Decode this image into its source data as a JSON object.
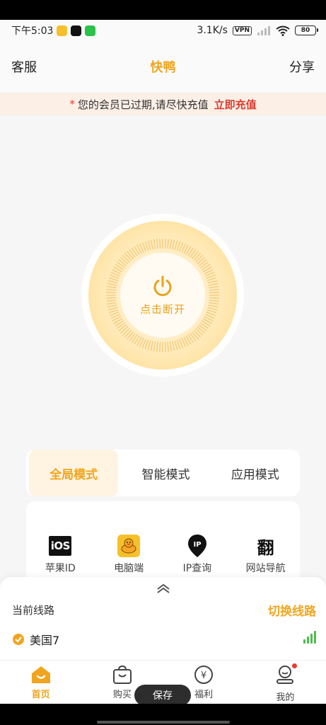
{
  "status_bar": {
    "time": "下午5:03",
    "network_speed": "3.1K/s",
    "vpn": "VPN",
    "battery": "80"
  },
  "nav": {
    "left": "客服",
    "title": "快鸭",
    "right": "分享"
  },
  "banner": {
    "star": "*",
    "message": "您的会员已过期,请尽快充值",
    "action": "立即充值"
  },
  "power": {
    "label": "点击断开"
  },
  "modes": [
    {
      "label": "全局模式",
      "active": true
    },
    {
      "label": "智能模式",
      "active": false
    },
    {
      "label": "应用模式",
      "active": false
    }
  ],
  "tools": [
    {
      "label": "苹果ID",
      "icon": "ios-icon",
      "icon_text": "iOS"
    },
    {
      "label": "电脑端",
      "icon": "duck-icon"
    },
    {
      "label": "IP查询",
      "icon": "ip-pin-icon",
      "icon_text": "IP"
    },
    {
      "label": "网站导航",
      "icon": "translate-icon",
      "icon_text": "翻"
    }
  ],
  "route": {
    "current_label": "当前线路",
    "switch_label": "切换线路",
    "server": "美国7"
  },
  "tab_bar": [
    {
      "label": "首页",
      "icon": "home-icon",
      "active": true
    },
    {
      "label": "购买",
      "icon": "bag-icon",
      "active": false
    },
    {
      "label": "福利",
      "icon": "yen-coin-icon",
      "active": false,
      "icon_text": "¥"
    },
    {
      "label": "我的",
      "icon": "profile-icon",
      "active": false
    }
  ],
  "toast": "保存",
  "colors": {
    "accent": "#f0a51f",
    "alert": "#e03a2f",
    "signal": "#4cc04c"
  }
}
